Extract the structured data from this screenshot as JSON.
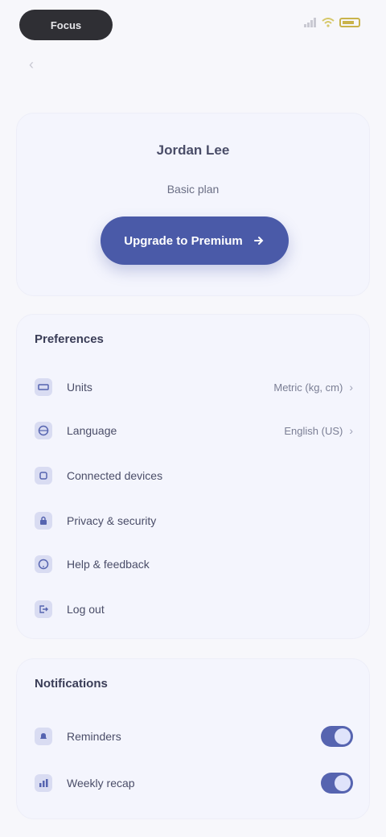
{
  "status": {
    "carrier_pill": "Focus",
    "time": ""
  },
  "header": {
    "back_glyph": "‹"
  },
  "profile": {
    "name": "Jordan Lee",
    "subtitle": "Basic plan",
    "cta_label": "Upgrade to Premium"
  },
  "preferences": {
    "title": "Preferences",
    "items": [
      {
        "label": "Units",
        "value": "Metric (kg, cm)",
        "icon": "ruler-icon"
      },
      {
        "label": "Language",
        "value": "English (US)",
        "icon": "globe-icon"
      },
      {
        "label": "Connected devices",
        "value": "",
        "icon": "watch-icon"
      },
      {
        "label": "Privacy & security",
        "value": "",
        "icon": "lock-icon"
      },
      {
        "label": "Help & feedback",
        "value": "",
        "icon": "help-icon"
      },
      {
        "label": "Log out",
        "value": "",
        "icon": "logout-icon"
      }
    ]
  },
  "notifications": {
    "title": "Notifications",
    "items": [
      {
        "label": "Reminders",
        "enabled": true,
        "icon": "bell-icon"
      },
      {
        "label": "Weekly recap",
        "enabled": true,
        "icon": "chart-icon"
      }
    ]
  },
  "colors": {
    "accent": "#4a5aa8",
    "background": "#f7f7fb",
    "card": "#f4f5fd"
  }
}
